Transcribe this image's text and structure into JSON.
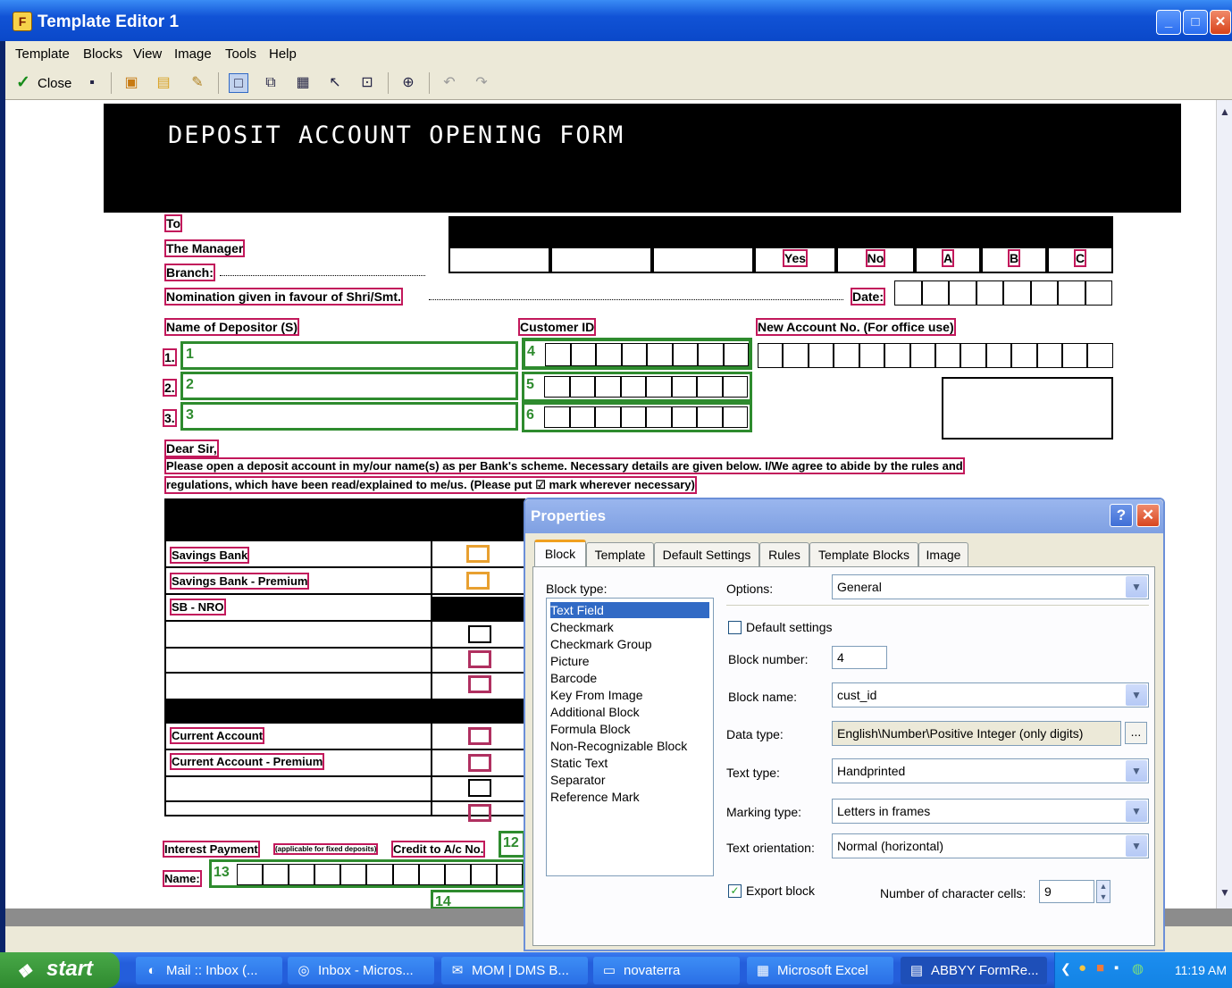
{
  "window": {
    "title": "Template Editor 1",
    "min": "_",
    "max": "□",
    "close": "✕"
  },
  "menu": [
    "Template",
    "Blocks",
    "View",
    "Image",
    "Tools",
    "Help"
  ],
  "toolbar": {
    "close_label": "Close"
  },
  "form": {
    "title": "DEPOSIT ACCOUNT OPENING FORM",
    "to": "To",
    "manager": "The Manager",
    "branch": "Branch:",
    "nomination": "Nomination given in favour of Shri/Smt.",
    "date": "Date:",
    "cols": [
      "Yes",
      "No",
      "A",
      "B",
      "C"
    ],
    "name_of_depositor": "Name of Depositor (S)",
    "customer_id": "Customer ID",
    "new_account": "New Account No. (For office use)",
    "rows": [
      "1.",
      "2.",
      "3."
    ],
    "dear_sir": "Dear Sir,",
    "para1": "Please open a deposit account in my/our name(s) as per Bank's scheme. Necessary details are given below. I/We agree to abide by the rules and",
    "para2": "regulations, which have been read/explained to me/us. (Please put ☑ mark wherever necessary)",
    "savings": [
      "Savings Bank",
      "Savings Bank - Premium",
      "SB - NRO"
    ],
    "current": [
      "Current Account",
      "Current Account - Premium"
    ],
    "interest": "Interest Payment",
    "interest_small": "(applicable for fixed deposits)",
    "credit": "Credit to A/c No.",
    "name": "Name:",
    "block_numbers": [
      "1",
      "2",
      "3",
      "4",
      "5",
      "6",
      "12",
      "13",
      "14"
    ]
  },
  "dialog": {
    "title": "Properties",
    "help": "?",
    "close": "✕",
    "tabs": [
      "Block",
      "Template",
      "Default Settings",
      "Rules",
      "Template Blocks",
      "Image"
    ],
    "block_type_label": "Block type:",
    "block_types": [
      "Text Field",
      "Checkmark",
      "Checkmark Group",
      "Picture",
      "Barcode",
      "Key From Image",
      "Additional Block",
      "Formula Block",
      "Non-Recognizable Block",
      "Static Text",
      "Separator",
      "Reference Mark"
    ],
    "options_label": "Options:",
    "options_value": "General",
    "default_settings_label": "Default settings",
    "block_number_label": "Block number:",
    "block_number_value": "4",
    "block_name_label": "Block name:",
    "block_name_value": "cust_id",
    "data_type_label": "Data type:",
    "data_type_value": "English\\Number\\Positive Integer (only digits)",
    "data_type_btn": "...",
    "text_type_label": "Text type:",
    "text_type_value": "Handprinted",
    "marking_type_label": "Marking type:",
    "marking_type_value": "Letters in frames",
    "text_orientation_label": "Text orientation:",
    "text_orientation_value": "Normal (horizontal)",
    "export_block_label": "Export block",
    "char_cells_label": "Number of character cells:",
    "char_cells_value": "9"
  },
  "taskbar": {
    "start": "start",
    "tasks": [
      "Mail :: Inbox (...",
      "Inbox - Micros...",
      "MOM | DMS B...",
      "novaterra",
      "Microsoft Excel",
      "ABBYY FormRe..."
    ],
    "clock": "11:19 AM"
  }
}
